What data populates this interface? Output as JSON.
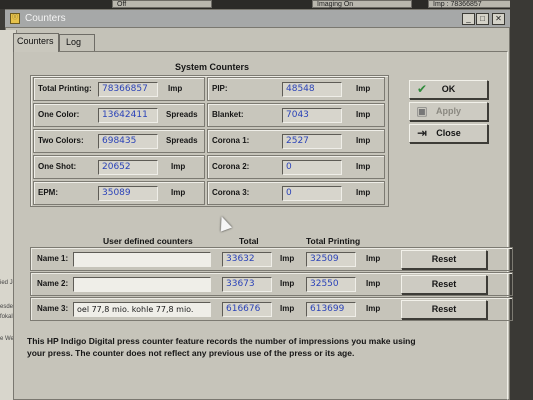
{
  "top_strip": {
    "box1": "Off",
    "box2": "Imaging On",
    "box3": "Imp : 78366857"
  },
  "background_left": [
    "ied Jo",
    "esde",
    "fokal",
    "e Wel"
  ],
  "window": {
    "title": "Counters",
    "icon_text": "Ⓘ",
    "min": "_",
    "max": "□",
    "close": "✕"
  },
  "tabs": [
    {
      "label": "Counters"
    },
    {
      "label": "Log"
    }
  ],
  "system_counters": {
    "heading": "System Counters",
    "left": [
      {
        "label": "Total Printing:",
        "value": "78366857",
        "unit": "Imp"
      },
      {
        "label": "One Color:",
        "value": "13642411",
        "unit": "Spreads"
      },
      {
        "label": "Two Colors:",
        "value": "698435",
        "unit": "Spreads"
      },
      {
        "label": "One Shot:",
        "value": "20652",
        "unit": "Imp"
      },
      {
        "label": "EPM:",
        "value": "35089",
        "unit": "Imp"
      }
    ],
    "right": [
      {
        "label": "PIP:",
        "value": "48548",
        "unit": "Imp"
      },
      {
        "label": "Blanket:",
        "value": "7043",
        "unit": "Imp"
      },
      {
        "label": "Corona 1:",
        "value": "2527",
        "unit": "Imp"
      },
      {
        "label": "Corona 2:",
        "value": "0",
        "unit": "Imp"
      },
      {
        "label": "Corona 3:",
        "value": "0",
        "unit": "Imp"
      }
    ]
  },
  "buttons": {
    "ok": "OK",
    "apply": "Apply",
    "close": "Close"
  },
  "user_counters": {
    "header_name": "User defined counters",
    "header_total": "Total",
    "header_total_printing": "Total Printing",
    "rows": [
      {
        "label": "Name 1:",
        "name": "",
        "total": "33632",
        "total_unit": "Imp",
        "printing": "32509",
        "printing_unit": "Imp",
        "reset": "Reset"
      },
      {
        "label": "Name 2:",
        "name": "",
        "total": "33673",
        "total_unit": "Imp",
        "printing": "32550",
        "printing_unit": "Imp",
        "reset": "Reset"
      },
      {
        "label": "Name 3:",
        "name": "oel 77,8 mio.   kohle 77,8 mio.",
        "total": "616676",
        "total_unit": "Imp",
        "printing": "613699",
        "printing_unit": "Imp",
        "reset": "Reset"
      }
    ]
  },
  "info_text": "This HP Indigo Digital press counter feature records the number of impressions you make using your press. The counter does not reflect any previous use of the press or its age."
}
